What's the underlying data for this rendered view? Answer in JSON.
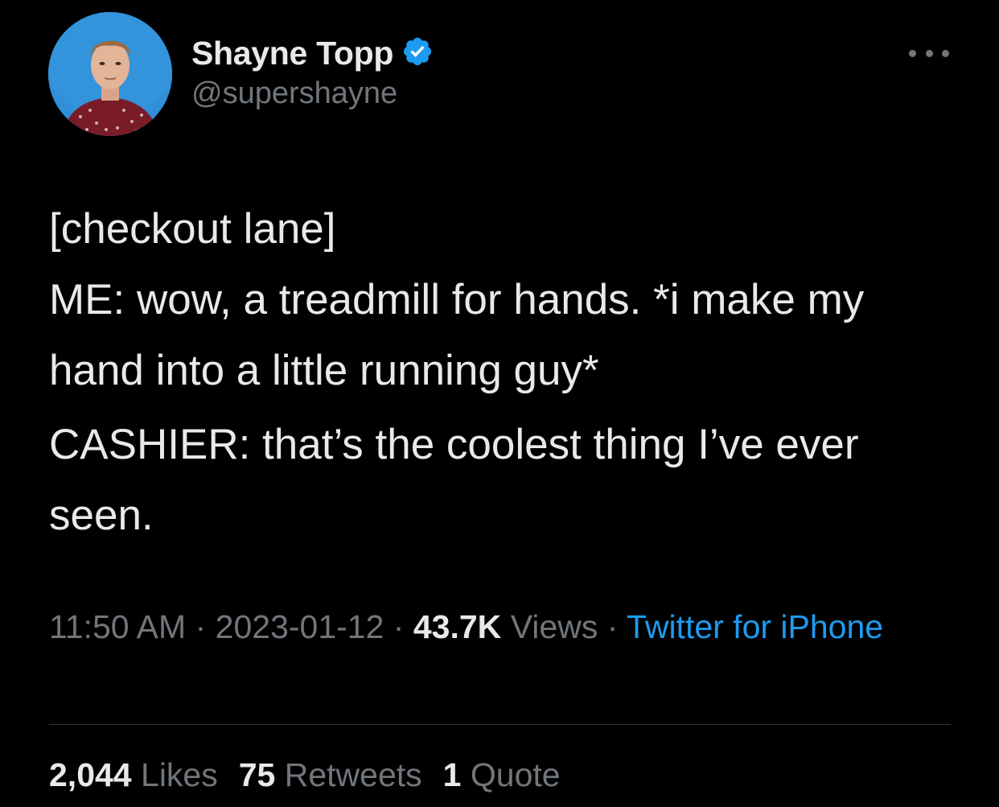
{
  "author": {
    "display_name": "Shayne Topp",
    "handle": "@supershayne",
    "verified_icon": "verified-badge-icon",
    "avatar_icon": "avatar"
  },
  "tweet": {
    "paragraphs": [
      "[checkout lane]\nME: wow, a treadmill for hands. *i make my hand into a little running guy*",
      "CASHIER: that’s the coolest thing I’ve ever seen."
    ],
    "time": "11:50 AM",
    "date": "2023-01-12",
    "views_count": "43.7K",
    "views_label": "Views",
    "source": "Twitter for iPhone",
    "separator": "·"
  },
  "stats": {
    "likes_count": "2,044",
    "likes_label": "Likes",
    "retweets_count": "75",
    "retweets_label": "Retweets",
    "quotes_count": "1",
    "quotes_label": "Quote"
  },
  "colors": {
    "background": "#000000",
    "text_primary": "#e7e9ea",
    "text_secondary": "#71767b",
    "accent": "#1d9bf0",
    "divider": "#2f3336"
  }
}
